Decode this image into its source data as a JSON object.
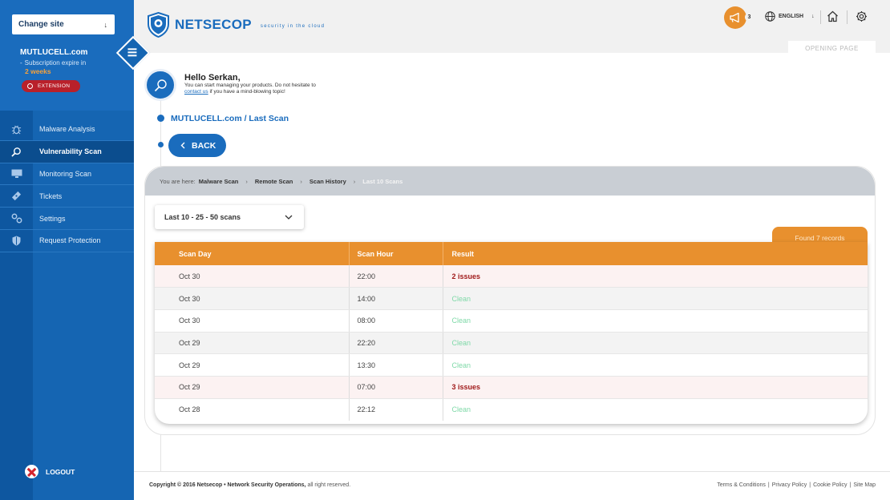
{
  "sidebar": {
    "change_site_label": "Change site",
    "site_name": "MUTLUCELL.com",
    "subscription_text": "Subscription expire in",
    "subscription_remaining": "2 weeks",
    "extension_label": "EXTENSION",
    "nav_items": [
      {
        "label": "Malware Analysis",
        "icon": "bug-icon"
      },
      {
        "label": "Vulnerability Scan",
        "icon": "magnifier-icon",
        "active": true
      },
      {
        "label": "Monitoring Scan",
        "icon": "monitor-icon"
      },
      {
        "label": "Tickets",
        "icon": "ticket-icon"
      },
      {
        "label": "Settings",
        "icon": "settings-icon"
      },
      {
        "label": "Request Protection",
        "icon": "shield-icon"
      }
    ],
    "logout_label": "LOGOUT"
  },
  "header": {
    "logo_text": "NETSECOP",
    "logo_tagline": "security in the cloud",
    "notification_count": "3",
    "language": "ENGLISH",
    "opening_page_tab": "OPENING PAGE"
  },
  "greeting": {
    "title": "Hello Serkan,",
    "line1": "You can start managing your products. Do not hesitate to",
    "contact_link": "contact us",
    "line2_rest": " if you have a mind-blowing topic!"
  },
  "page_title": "MUTLUCELL.com / Last Scan",
  "back_label": "BACK",
  "breadcrumb": {
    "prefix": "You are here:",
    "items": [
      "Malware Scan",
      "Remote Scan",
      "Scan History",
      "Last 10 Scans"
    ]
  },
  "filter_select": {
    "value": "Last 10 - 25 - 50 scans"
  },
  "found_records": "Found 7 records",
  "table": {
    "headers": [
      "Scan Day",
      "Scan Hour",
      "Result"
    ],
    "rows": [
      {
        "day": "Oct 30",
        "hour": "22:00",
        "result": "2 issues",
        "status": "issues"
      },
      {
        "day": "Oct 30",
        "hour": "14:00",
        "result": "Clean",
        "status": "clean"
      },
      {
        "day": "Oct 30",
        "hour": "08:00",
        "result": "Clean",
        "status": "clean"
      },
      {
        "day": "Oct 29",
        "hour": "22:20",
        "result": "Clean",
        "status": "clean"
      },
      {
        "day": "Oct 29",
        "hour": "13:30",
        "result": "Clean",
        "status": "clean"
      },
      {
        "day": "Oct 29",
        "hour": "07:00",
        "result": "3 issues",
        "status": "issues"
      },
      {
        "day": "Oct 28",
        "hour": "22:12",
        "result": "Clean",
        "status": "clean"
      }
    ]
  },
  "footer": {
    "copyright_bold": "Copyright © 2016 Netsecop • Network Security Operations,",
    "copyright_rest": " all right reserved.",
    "links": [
      "Terms & Conditions",
      "Privacy Policy",
      "Cookie Policy",
      "Site Map"
    ]
  },
  "colors": {
    "brand_blue": "#1a6cbd",
    "accent_orange": "#e8902e",
    "issue_red": "#a01b1b",
    "clean_green": "#7fd9a8"
  }
}
